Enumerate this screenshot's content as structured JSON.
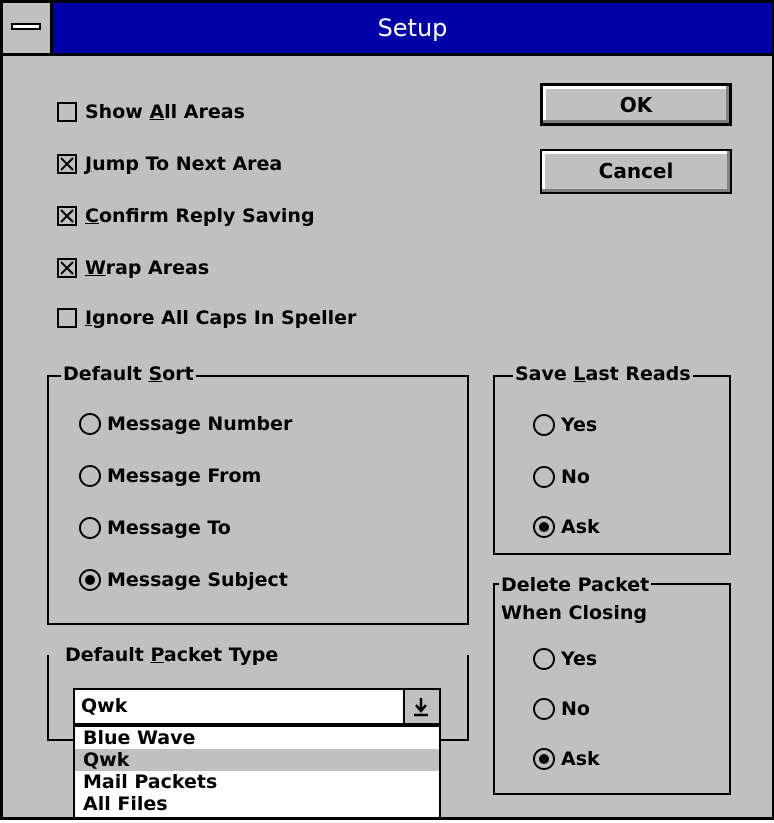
{
  "window": {
    "title": "Setup"
  },
  "checkboxes": [
    {
      "label_pre": "Show ",
      "accel": "A",
      "label_post": "ll Areas",
      "checked": false
    },
    {
      "label_pre": "",
      "accel": "J",
      "label_post": "ump To Next Area",
      "checked": true
    },
    {
      "label_pre": "",
      "accel": "C",
      "label_post": "onfirm Reply Saving",
      "checked": true
    },
    {
      "label_pre": "",
      "accel": "W",
      "label_post": "rap Areas",
      "checked": true
    },
    {
      "label_pre": "",
      "accel": "I",
      "label_post": "gnore All Caps In Speller",
      "checked": false
    }
  ],
  "buttons": {
    "ok": "OK",
    "cancel": "Cancel"
  },
  "default_sort": {
    "title_pre": "Default ",
    "title_accel": "S",
    "title_post": "ort",
    "options": [
      "Message Number",
      "Message From",
      "Message To",
      "Message Subject"
    ],
    "selected": "Message Subject"
  },
  "save_last_reads": {
    "title_pre": "Save ",
    "title_accel": "L",
    "title_post": "ast Reads",
    "options": [
      "Yes",
      "No",
      "Ask"
    ],
    "selected": "Ask"
  },
  "delete_packet": {
    "title_line1": "Delete Packet",
    "title_line2": "When Closing",
    "options": [
      "Yes",
      "No",
      "Ask"
    ],
    "selected": "Ask"
  },
  "default_packet_type": {
    "title_pre": "Default ",
    "title_accel": "P",
    "title_post": "acket Type",
    "value": "Qwk",
    "dropdown_icon": "down-arrow-bar-icon",
    "list": [
      "Blue Wave",
      "Qwk",
      "Mail Packets",
      "All Files"
    ],
    "highlighted": "Qwk"
  }
}
